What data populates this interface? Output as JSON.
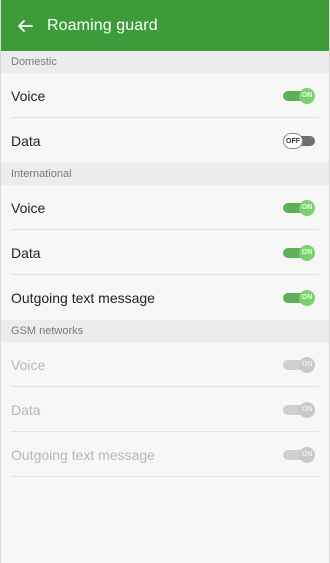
{
  "appbar": {
    "title": "Roaming guard"
  },
  "domestic": {
    "header": "Domestic",
    "items": [
      {
        "label": "Voice",
        "state": "ON"
      },
      {
        "label": "Data",
        "state": "OFF"
      }
    ]
  },
  "international": {
    "header": "International",
    "items": [
      {
        "label": "Voice",
        "state": "ON"
      },
      {
        "label": "Data",
        "state": "ON"
      },
      {
        "label": "Outgoing text message",
        "state": "ON"
      }
    ]
  },
  "gsm": {
    "header": "GSM networks",
    "items": [
      {
        "label": "Voice",
        "state": "ON"
      },
      {
        "label": "Data",
        "state": "ON"
      },
      {
        "label": "Outgoing text message",
        "state": "ON"
      }
    ]
  },
  "colors": {
    "appbar": "#3d9c3a",
    "toggle_on": "#7bd06f",
    "toggle_disabled": "#c9c9c9"
  }
}
